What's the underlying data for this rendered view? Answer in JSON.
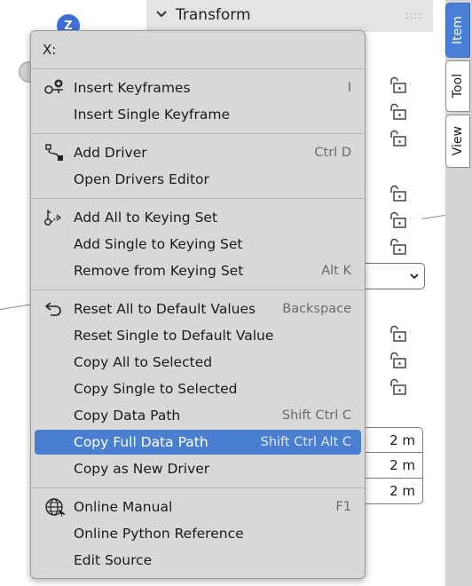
{
  "gizmo": {
    "z_label": "Z"
  },
  "n_panel": {
    "header_title": "Transform",
    "grip": "::::",
    "dropdown_arrow": "⌄",
    "value_fields": [
      "2 m",
      "2 m",
      "2 m"
    ]
  },
  "tabs": [
    {
      "label": "Item",
      "active": true
    },
    {
      "label": "Tool",
      "active": false
    },
    {
      "label": "View",
      "active": false
    }
  ],
  "menu": {
    "title": "X:",
    "groups": [
      {
        "items": [
          {
            "label": "Insert Keyframes",
            "shortcut": "I",
            "icon": "keyframe-insert-icon"
          },
          {
            "label": "Insert Single Keyframe",
            "shortcut": ""
          }
        ]
      },
      {
        "items": [
          {
            "label": "Add Driver",
            "shortcut": "Ctrl D",
            "icon": "driver-icon"
          },
          {
            "label": "Open Drivers Editor",
            "shortcut": ""
          }
        ]
      },
      {
        "items": [
          {
            "label": "Add All to Keying Set",
            "shortcut": "",
            "icon": "keying-set-icon"
          },
          {
            "label": "Add Single to Keying Set",
            "shortcut": ""
          },
          {
            "label": "Remove from Keying Set",
            "shortcut": "Alt K"
          }
        ]
      },
      {
        "items": [
          {
            "label": "Reset All to Default Values",
            "shortcut": "Backspace",
            "icon": "reset-icon"
          },
          {
            "label": "Reset Single to Default Value",
            "shortcut": ""
          },
          {
            "label": "Copy All to Selected",
            "shortcut": ""
          },
          {
            "label": "Copy Single to Selected",
            "shortcut": ""
          },
          {
            "label": "Copy Data Path",
            "shortcut": "Shift Ctrl C"
          },
          {
            "label": "Copy Full Data Path",
            "shortcut": "Shift Ctrl Alt C",
            "highlighted": true
          },
          {
            "label": "Copy as New Driver",
            "shortcut": ""
          }
        ]
      },
      {
        "items": [
          {
            "label": "Online Manual",
            "shortcut": "F1",
            "icon": "globe-icon"
          },
          {
            "label": "Online Python Reference",
            "shortcut": ""
          },
          {
            "label": "Edit Source",
            "shortcut": ""
          }
        ]
      }
    ]
  },
  "colors": {
    "highlight": "#4a7fd0",
    "menu_bg": "#d8d8d8",
    "active_tab": "#4a7fd8",
    "gizmo_z": "#3d6fd6"
  }
}
